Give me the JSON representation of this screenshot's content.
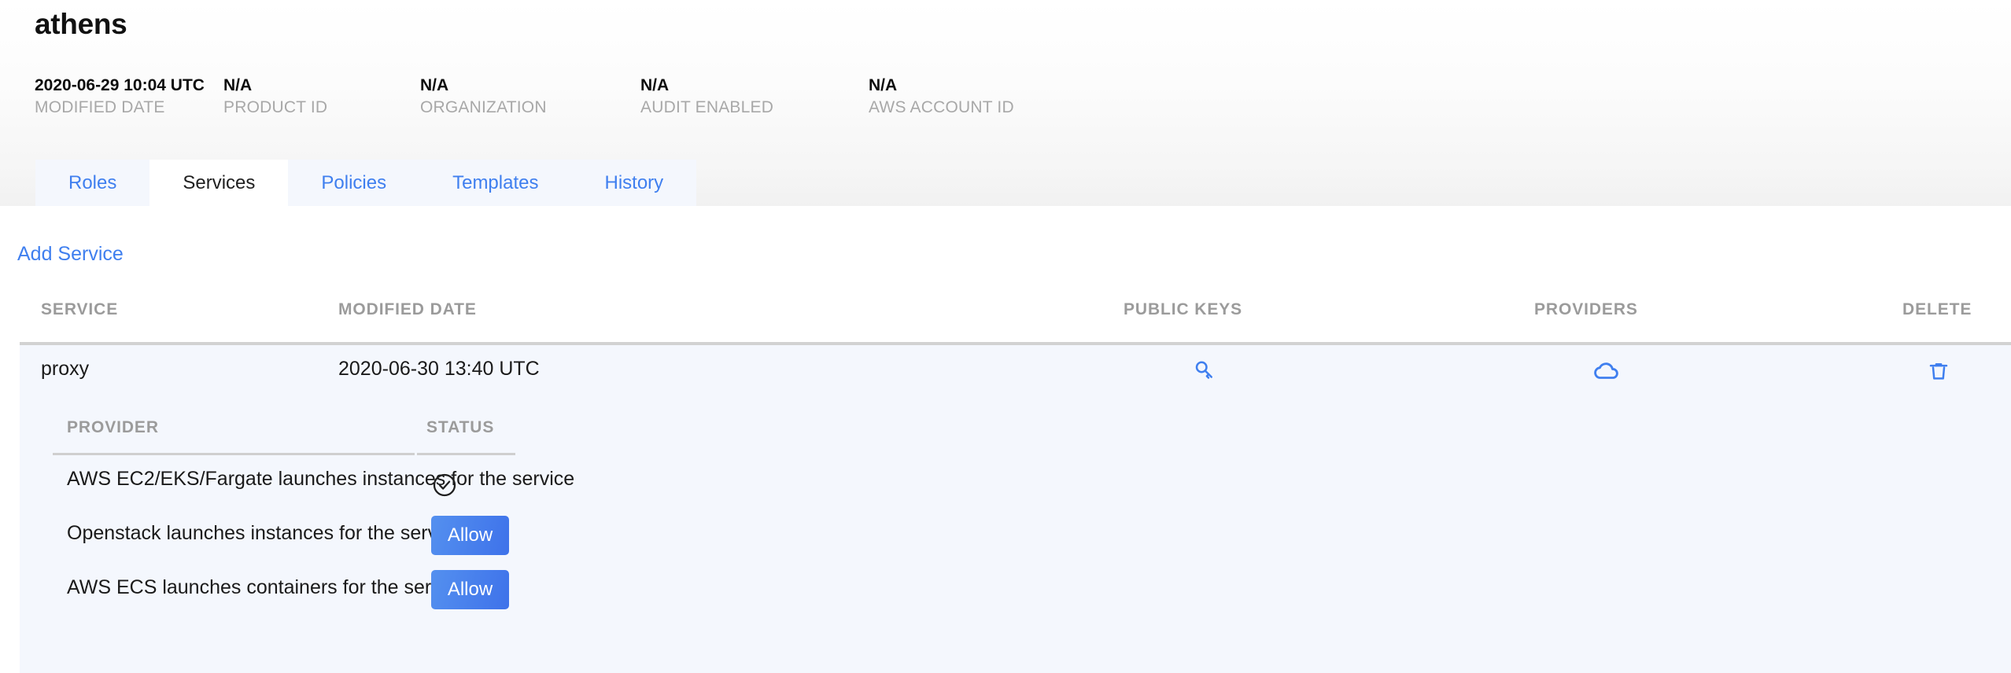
{
  "header": {
    "title": "athens",
    "meta": [
      {
        "value": "2020-06-29 10:04 UTC",
        "label": "MODIFIED DATE"
      },
      {
        "value": "N/A",
        "label": "PRODUCT ID"
      },
      {
        "value": "N/A",
        "label": "ORGANIZATION"
      },
      {
        "value": "N/A",
        "label": "AUDIT ENABLED"
      },
      {
        "value": "N/A",
        "label": "AWS ACCOUNT ID"
      }
    ]
  },
  "tabs": [
    {
      "label": "Roles",
      "active": false
    },
    {
      "label": "Services",
      "active": true
    },
    {
      "label": "Policies",
      "active": false
    },
    {
      "label": "Templates",
      "active": false
    },
    {
      "label": "History",
      "active": false
    }
  ],
  "actions": {
    "add_service_label": "Add Service"
  },
  "services_table": {
    "columns": {
      "service": "SERVICE",
      "modified_date": "MODIFIED DATE",
      "public_keys": "PUBLIC KEYS",
      "providers": "PROVIDERS",
      "delete": "DELETE"
    },
    "rows": [
      {
        "service": "proxy",
        "modified_date": "2020-06-30 13:40 UTC",
        "public_keys_icon": "key-icon",
        "providers_icon": "cloud-icon",
        "delete_icon": "trash-icon"
      }
    ]
  },
  "providers_table": {
    "columns": {
      "provider": "PROVIDER",
      "status": "STATUS"
    },
    "rows": [
      {
        "provider": "AWS EC2/EKS/Fargate launches instances for the service",
        "status_type": "enabled",
        "status_icon": "check-circle-icon",
        "status_label": ""
      },
      {
        "provider": "Openstack launches instances for the service",
        "status_type": "button",
        "status_icon": "",
        "status_label": "Allow"
      },
      {
        "provider": "AWS ECS launches containers for the service",
        "status_type": "button",
        "status_icon": "",
        "status_label": "Allow"
      }
    ]
  },
  "colors": {
    "accent_blue": "#3f7fef",
    "tab_strip_bg": "#f4f7fd",
    "panel_bg": "#f4f7fd",
    "button_gradient_start": "#5490ef",
    "button_gradient_end": "#3e72ea",
    "muted_label": "#9b9b9b"
  }
}
